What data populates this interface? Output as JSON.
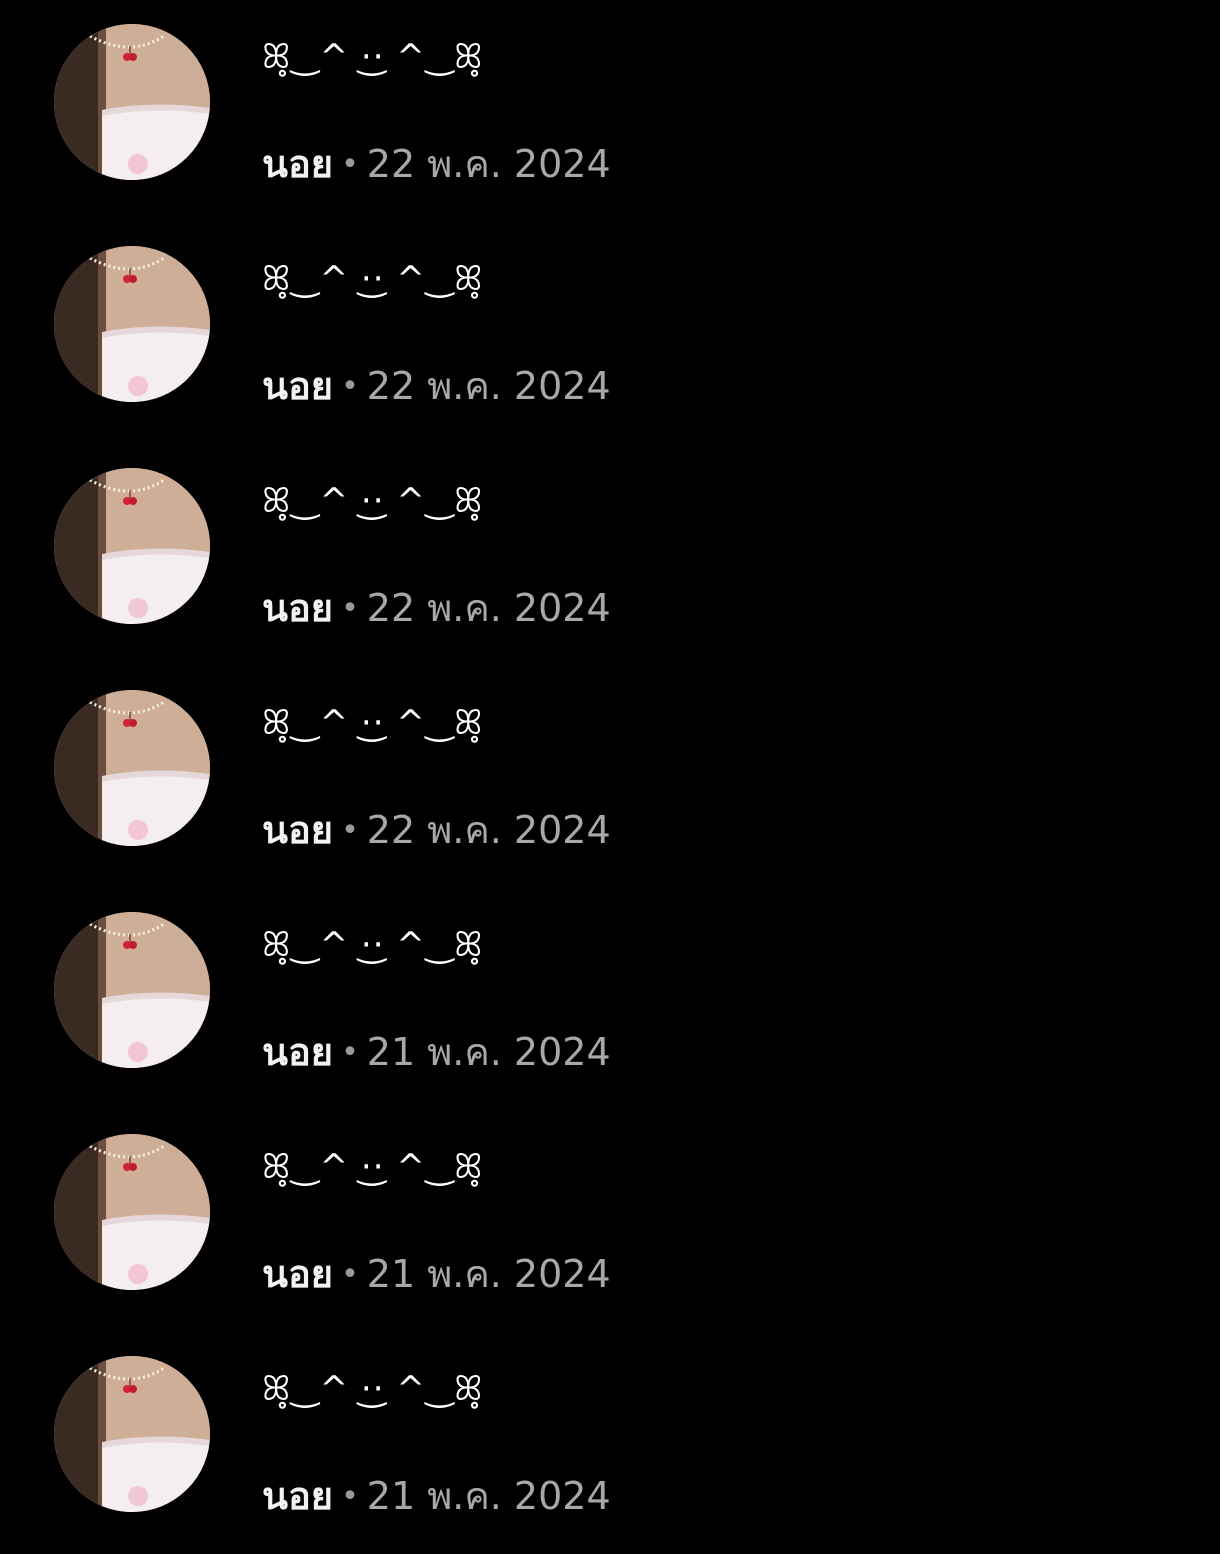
{
  "comments": [
    {
      "text": "ꕤ̥‿ ⸝⸝ ̫ ⸝⸝ ‿ꕤ̥",
      "kaomoji": "ꕤ̥‿^ ·͜· ^‿ꕤ̥",
      "author": "นอย",
      "separator": "•",
      "date": "22 พ.ค. 2024"
    },
    {
      "text": "ꕤ̥‿ ⸝⸝ ̫ ⸝⸝ ‿ꕤ̥",
      "kaomoji": "ꕤ̥‿^ ·͜· ^‿ꕤ̥",
      "author": "นอย",
      "separator": "•",
      "date": "22 พ.ค. 2024"
    },
    {
      "text": "ꕤ̥‿ ⸝⸝ ̫ ⸝⸝ ‿ꕤ̥",
      "kaomoji": "ꕤ̥‿^ ·͜· ^‿ꕤ̥",
      "author": "นอย",
      "separator": "•",
      "date": "22 พ.ค. 2024"
    },
    {
      "text": "ꕤ̥‿ ⸝⸝ ̫ ⸝⸝ ‿ꕤ̥",
      "kaomoji": "ꕤ̥‿^ ·͜· ^‿ꕤ̥",
      "author": "นอย",
      "separator": "•",
      "date": "22 พ.ค. 2024"
    },
    {
      "text": "ꕤ̥‿ ⸝⸝ ̫ ⸝⸝ ‿ꕤ̥",
      "kaomoji": "ꕤ̥‿^ ·͜· ^‿ꕤ̥",
      "author": "นอย",
      "separator": "•",
      "date": "21 พ.ค. 2024"
    },
    {
      "text": "ꕤ̥‿ ⸝⸝ ̫ ⸝⸝ ‿ꕤ̥",
      "kaomoji": "ꕤ̥‿^ ·͜· ^‿ꕤ̥",
      "author": "นอย",
      "separator": "•",
      "date": "21 พ.ค. 2024"
    },
    {
      "text": "ꕤ̥‿ ⸝⸝ ̫ ⸝⸝ ‿ꕤ̥",
      "kaomoji": "ꕤ̥‿^ ·͜· ^‿ꕤ̥",
      "author": "นอย",
      "separator": "•",
      "date": "21 พ.ค. 2024"
    }
  ],
  "colors": {
    "background": "#000000",
    "text_primary": "#f2f2f2",
    "text_secondary": "#a8a8a8"
  },
  "icons": {
    "avatar": "profile-photo"
  }
}
